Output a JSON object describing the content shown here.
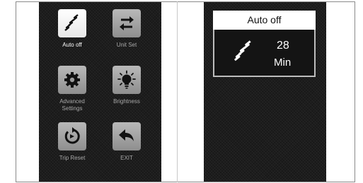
{
  "menu": {
    "items": [
      {
        "label": "Auto off",
        "icon": "sleep-zigzag-icon",
        "selected": true
      },
      {
        "label": "Unit Set",
        "icon": "swap-arrows-icon",
        "selected": false
      },
      {
        "label": "Advanced Settings",
        "icon": "gear-icon",
        "selected": false
      },
      {
        "label": "Brightness",
        "icon": "lightbulb-icon",
        "selected": false
      },
      {
        "label": "Trip Reset",
        "icon": "reset-icon",
        "selected": false
      },
      {
        "label": "EXIT",
        "icon": "back-arrow-icon",
        "selected": false
      }
    ]
  },
  "detail": {
    "title": "Auto off",
    "value": "28",
    "unit": "Min",
    "icon": "sleep-zigzag-icon"
  },
  "colors": {
    "screen_background": "#1d1d1d",
    "tile": "#a5a5a5",
    "tile_selected": "#ffffff",
    "label": "#a8a8a8",
    "label_active": "#ffffff"
  }
}
